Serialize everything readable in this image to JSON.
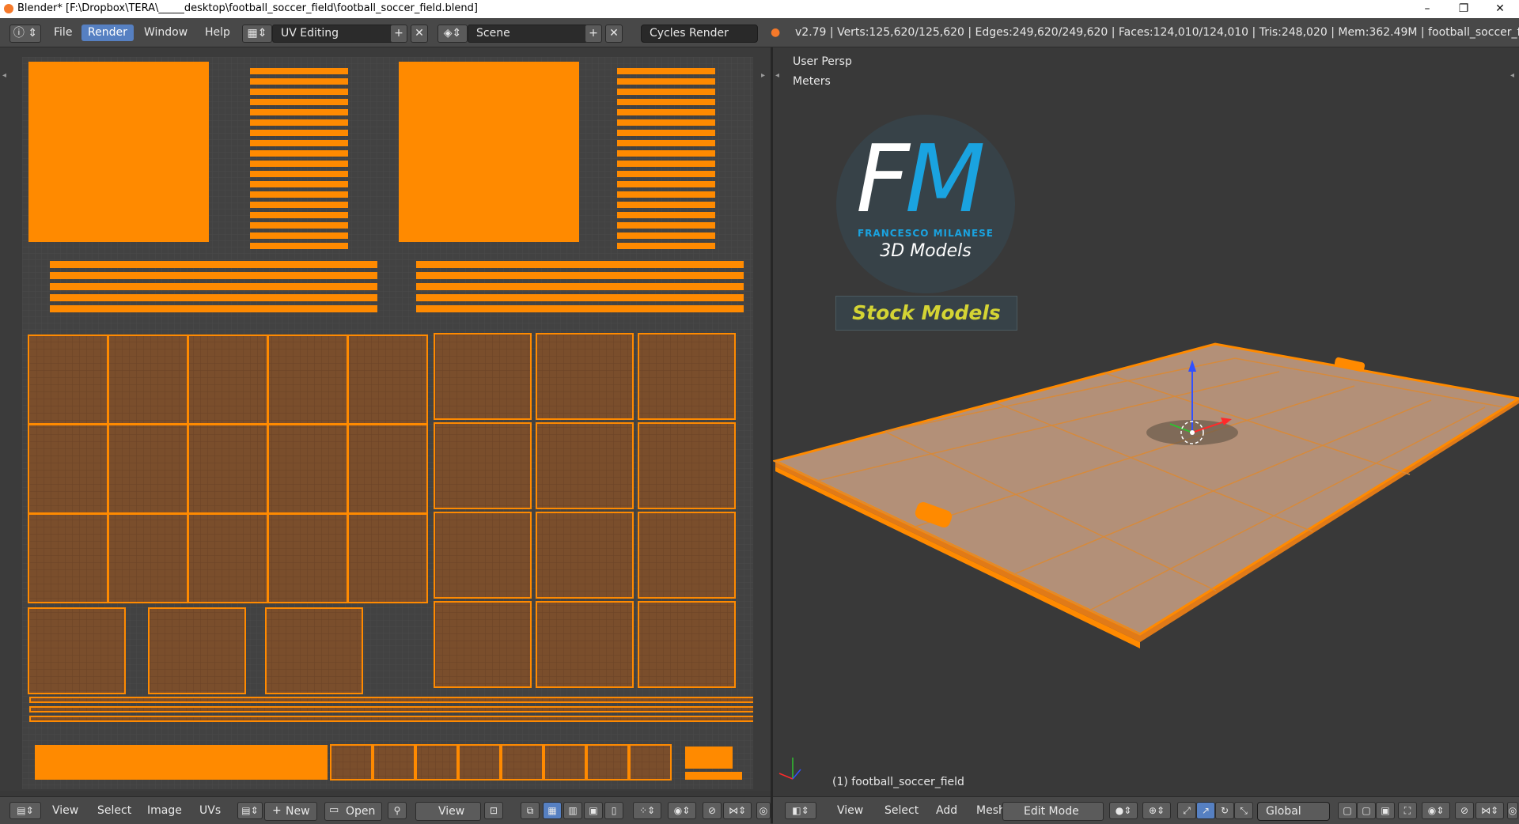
{
  "window": {
    "title": "Blender* [F:\\Dropbox\\TERA\\_____desktop\\football_soccer_field\\football_soccer_field.blend]",
    "controls": [
      "–",
      "❐",
      "✕"
    ]
  },
  "topbar": {
    "menus": [
      "File",
      "Render",
      "Window",
      "Help"
    ],
    "active_menu": "Render",
    "layout_name": "UV Editing",
    "scene_name": "Scene",
    "render_engine": "Cycles Render",
    "stats": "v2.79 | Verts:125,620/125,620 | Edges:249,620/249,620 | Faces:124,010/124,010 | Tris:248,020 | Mem:362.49M | football_soccer_field"
  },
  "viewport": {
    "view_label": "User Persp",
    "units_label": "Meters",
    "object_label": "(1) football_soccer_field"
  },
  "logo": {
    "letter_f": "F",
    "letter_m": "M",
    "name": "FRANCESCO MILANESE",
    "subtitle": "3D Models",
    "banner": "Stock Models"
  },
  "uv_header": {
    "view": "View",
    "select": "Select",
    "image": "Image",
    "uvs": "UVs",
    "new": "New",
    "open": "Open",
    "view2": "View"
  },
  "viewport_header": {
    "view": "View",
    "select": "Select",
    "add": "Add",
    "mesh": "Mesh",
    "mode": "Edit Mode",
    "orientation": "Global"
  },
  "colors": {
    "uv_selected": "#ff8a00",
    "uv_face": "#7a4e2c",
    "uv_edge": "#ff8a00",
    "active_menu": "#5680c2",
    "logo_blue": "#1aa3e0",
    "logo_yellow": "#d4d434"
  }
}
